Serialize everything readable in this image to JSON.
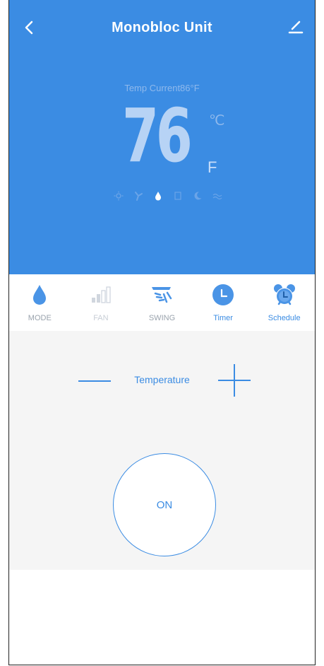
{
  "header": {
    "title": "Monobloc  Unit",
    "back_icon": "chevron-left-icon",
    "edit_icon": "edit-icon"
  },
  "status": {
    "temp_current_label": "Temp Current86°F",
    "set_temperature": "76",
    "unit_celsius": "℃",
    "unit_fahrenheit": "F",
    "mode_icons": [
      "sun-icon",
      "fan-icon",
      "drop-icon",
      "auto-icon",
      "moon-icon",
      "wave-icon"
    ],
    "active_mode_icon": "drop-icon"
  },
  "toolbar": {
    "items": [
      {
        "label": "MODE",
        "icon": "drop-icon",
        "color": "#9aa3ad"
      },
      {
        "label": "FAN",
        "icon": "signal-bars-icon",
        "color": "#c8ced6"
      },
      {
        "label": "SWING",
        "icon": "swing-icon",
        "color": "#9aa3ad"
      },
      {
        "label": "Timer",
        "icon": "clock-icon",
        "color": "#3b8ce3"
      },
      {
        "label": "Schedule",
        "icon": "alarm-clock-icon",
        "color": "#3b8ce3"
      }
    ]
  },
  "controls": {
    "temperature_label": "Temperature",
    "power_label": "ON"
  },
  "colors": {
    "accent": "#3b8ce3",
    "panel_background": "#f5f5f5"
  }
}
